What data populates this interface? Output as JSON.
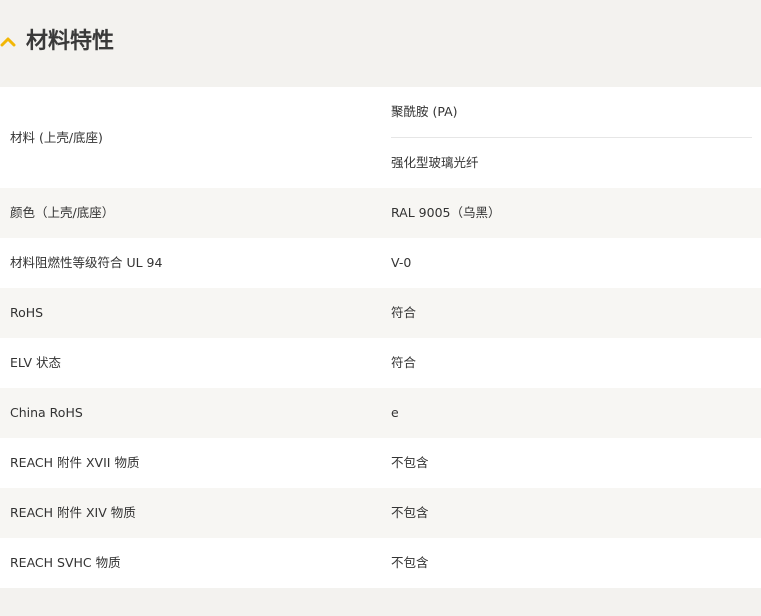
{
  "section": {
    "title": "材料特性",
    "icon": "chevron-up-icon",
    "accent_color": "#f2b705"
  },
  "rows": [
    {
      "label": "材料 (上壳/底座)",
      "values": [
        "聚酰胺 (PA)",
        "强化型玻璃光纤"
      ]
    },
    {
      "label": "颜色（上壳/底座）",
      "values": [
        "RAL 9005（乌黑）"
      ]
    },
    {
      "label": "材料阻燃性等级符合 UL 94",
      "values": [
        "V-0"
      ]
    },
    {
      "label": "RoHS",
      "values": [
        "符合"
      ]
    },
    {
      "label": "ELV 状态",
      "values": [
        "符合"
      ]
    },
    {
      "label": "China RoHS",
      "values": [
        "e"
      ]
    },
    {
      "label": "REACH 附件 XVII 物质",
      "values": [
        "不包含"
      ]
    },
    {
      "label": "REACH 附件 XIV 物质",
      "values": [
        "不包含"
      ]
    },
    {
      "label": "REACH SVHC 物质",
      "values": [
        "不包含"
      ]
    }
  ]
}
